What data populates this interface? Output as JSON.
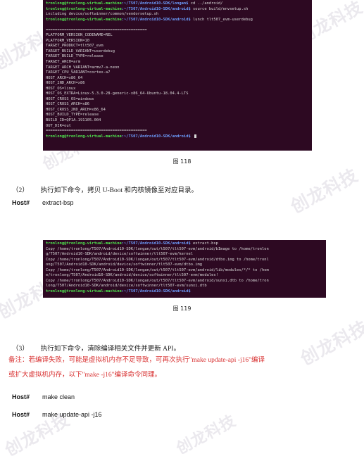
{
  "document": {
    "watermark_text": "创龙科技",
    "accent_note_color": "#d83030",
    "terminal_bg": "#2d0922",
    "prompt_user_color": "#4ee44e",
    "prompt_path_color": "#6d9eff"
  },
  "terminal_1": {
    "lines": [
      {
        "user": "tronlong@tronlong-virtual-machine",
        "path": ":~/T507/Android10-SDK/longan$",
        "text": " cd ../android/"
      },
      {
        "user": "tronlong@tronlong-virtual-machine",
        "path": ":~/T507/Android10-SDK/android$",
        "text": " source build/envsetup.sh"
      },
      {
        "text": "including device/softwinner/common/vendorsetup.sh"
      },
      {
        "user": "tronlong@tronlong-virtual-machine",
        "path": ":~/T507/Android10-SDK/android$",
        "text": " lunch tlt507_evm-userdebug"
      },
      {
        "text": ""
      },
      {
        "text": "============================================"
      },
      {
        "text": "PLATFORM_VERSION_CODENAME=REL"
      },
      {
        "text": "PLATFORM_VERSION=10"
      },
      {
        "text": "TARGET_PRODUCT=tlt507_evm"
      },
      {
        "text": "TARGET_BUILD_VARIANT=userdebug"
      },
      {
        "text": "TARGET_BUILD_TYPE=release"
      },
      {
        "text": "TARGET_ARCH=arm"
      },
      {
        "text": "TARGET_ARCH_VARIANT=armv7-a-neon"
      },
      {
        "text": "TARGET_CPU_VARIANT=cortex-a7"
      },
      {
        "text": "HOST_ARCH=x86_64"
      },
      {
        "text": "HOST_2ND_ARCH=x86"
      },
      {
        "text": "HOST_OS=linux"
      },
      {
        "text": "HOST_OS_EXTRA=Linux-5.3.0-28-generic-x86_64-Ubuntu-18.04.4-LTS"
      },
      {
        "text": "HOST_CROSS_OS=windows"
      },
      {
        "text": "HOST_CROSS_ARCH=x86"
      },
      {
        "text": "HOST_CROSS_2ND_ARCH=x86_64"
      },
      {
        "text": "HOST_BUILD_TYPE=release"
      },
      {
        "text": "BUILD_ID=QP1A.191105.004"
      },
      {
        "text": "OUT_DIR=out"
      },
      {
        "text": "============================================"
      },
      {
        "user": "tronlong@tronlong-virtual-machine",
        "path": ":~/T507/Android10-SDK/android$",
        "text": " ",
        "cursor": true
      }
    ]
  },
  "terminal_2": {
    "lines": [
      {
        "user": "tronlong@tronlong-virtual-machine",
        "path": ":~/T507/Android10-SDK/android$",
        "text": " extract-bsp"
      },
      {
        "text": "Copy /home/tronlong/T507/Android10-SDK/longan/out/t507/tlt507-evm/android/bImage to /home/tronlon"
      },
      {
        "text": "g/T507/Android10-SDK/android/device/softwinner/tlt507-evm/kernel"
      },
      {
        "text": "Copy /home/tronlong/T507/Android10-SDK/longan/out/t507/tlt507-evm/android/dtbo.img to /home/tronl"
      },
      {
        "text": "ong/T507/Android10-SDK/android/device/softwinner/tlt507-evm/dtbo.img"
      },
      {
        "text": "Copy /home/tronlong/T507/Android10-SDK/longan/out/t507/tlt507-evm/android/lib/modules/*/* to /hom"
      },
      {
        "text": "e/tronlong/T507/Android10-SDK/android/device/softwinner/tlt507-evm/modules!"
      },
      {
        "text": "Copy /home/tronlong/T507/Android10-SDK/longan/out/t507/tlt507-evm/android/sunxi.dtb to /home/tron"
      },
      {
        "text": "long/T507/Android10-SDK/android/device/softwinner/tlt507-evm/sunxi.dtb"
      },
      {
        "user": "tronlong@tronlong-virtual-machine",
        "path": ":~/T507/Android10-SDK/android$",
        "text": ""
      }
    ]
  },
  "captions": {
    "figure_118": "图 118",
    "figure_119": "图 119"
  },
  "steps": {
    "step_2_number": "（2）",
    "step_2_body": "执行如下命令，拷贝 U-Boot 和内核镜像至对应目录。",
    "step_3_number": "（3）",
    "step_3_body": "执行如下命令，清除编译相关文件并更新 API。"
  },
  "note": {
    "line_1": "备注：若编译失败，可能是虚拟机内存不足导致，可再次执行\"make update-api -j16\"编译",
    "line_2": "或扩大虚拟机内存，以下\"make -j16\"编译命令同理。"
  },
  "commands": {
    "host_label": "Host#",
    "extract_bsp": "extract-bsp",
    "make_clean": "make clean",
    "make_update_api": "make update-api -j16"
  }
}
